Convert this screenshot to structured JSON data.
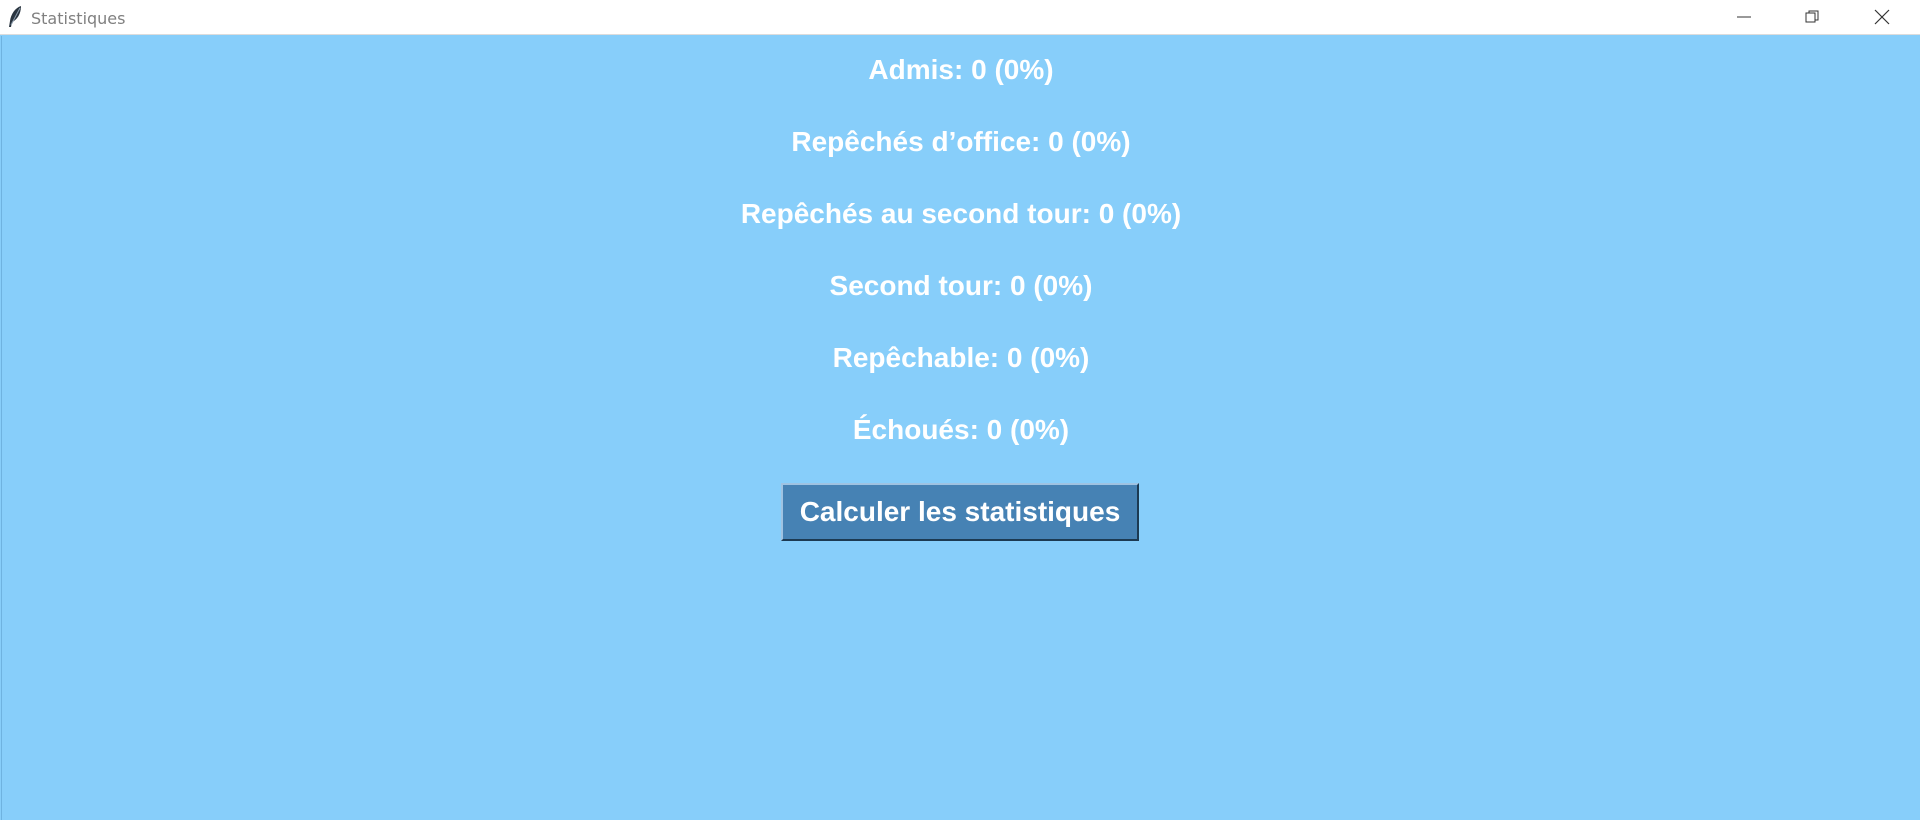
{
  "window": {
    "title": "Statistiques",
    "icon": "feather-icon",
    "controls": [
      "minimize-icon",
      "restore-icon",
      "close-icon"
    ]
  },
  "colors": {
    "background": "#87cefa",
    "text": "#ffffff",
    "button_bg": "#4682b4"
  },
  "stats": [
    {
      "label": "Admis: 0 (0%)"
    },
    {
      "label": "Repêchés d’office: 0 (0%)"
    },
    {
      "label": "Repêchés au second tour: 0 (0%)"
    },
    {
      "label": "Second tour: 0 (0%)"
    },
    {
      "label": "Repêchable: 0 (0%)"
    },
    {
      "label": "Échoués: 0 (0%)"
    }
  ],
  "actions": {
    "calculate_label": "Calculer les statistiques"
  }
}
